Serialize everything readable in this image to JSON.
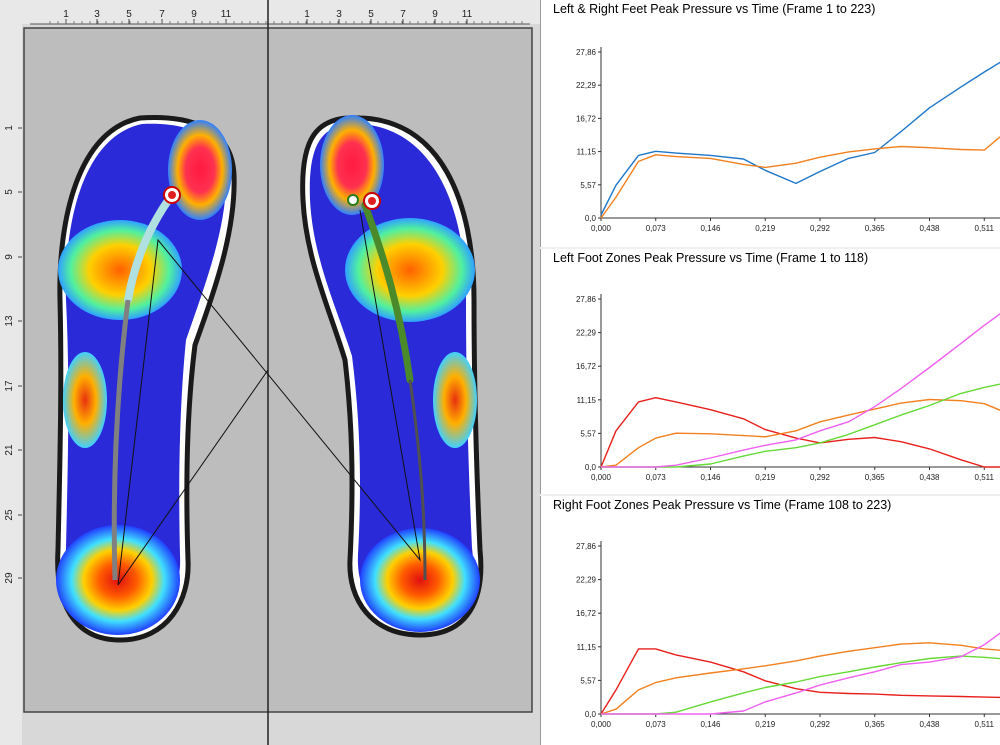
{
  "colors": {
    "series_blue": "#1f77c9",
    "series_orange": "#f28020",
    "series_red": "#e8201c",
    "series_green": "#66d936",
    "series_magenta": "#f060f0",
    "panel_grey": "#bdbdbd"
  },
  "ruler": {
    "top_labels": [
      "1",
      "3",
      "5",
      "7",
      "9",
      "11",
      "1",
      "3",
      "5",
      "7",
      "9",
      "11"
    ],
    "side_labels": [
      "1",
      "5",
      "9",
      "13",
      "17",
      "21",
      "25",
      "29"
    ]
  },
  "footprint_panel": {
    "left_foot": "left-foot-pressure-map",
    "right_foot": "right-foot-pressure-map",
    "markers": "center-of-pressure-icon"
  },
  "chart_data": [
    {
      "type": "line",
      "title": "Left & Right Feet Peak Pressure vs Time (Frame 1 to 223)",
      "x": [
        0.0,
        0.02,
        0.05,
        0.073,
        0.1,
        0.146,
        0.19,
        0.219,
        0.26,
        0.292,
        0.33,
        0.365,
        0.4,
        0.438,
        0.48,
        0.511,
        0.55
      ],
      "x_ticks": [
        "0,000",
        "0,073",
        "0,146",
        "0,219",
        "0,292",
        "0,365",
        "0,438",
        "0,511"
      ],
      "y_ticks": [
        "0,0",
        "5,57",
        "11,15",
        "16,72",
        "22,29",
        "27,86"
      ],
      "ylim": [
        0,
        27.86
      ],
      "xlim": [
        0,
        0.54
      ],
      "series": [
        {
          "color": "#1f77c9",
          "values": [
            0.5,
            5.5,
            10.5,
            11.2,
            10.9,
            10.5,
            9.9,
            8.0,
            5.8,
            7.8,
            10.0,
            11.0,
            14.5,
            18.5,
            22.0,
            24.5,
            27.5
          ]
        },
        {
          "color": "#f28020",
          "values": [
            0.0,
            3.5,
            9.5,
            10.6,
            10.3,
            10.0,
            9.0,
            8.5,
            9.2,
            10.2,
            11.1,
            11.6,
            12.0,
            11.8,
            11.5,
            11.4,
            15.5
          ]
        }
      ]
    },
    {
      "type": "line",
      "title": "Left Foot Zones Peak Pressure vs Time (Frame 1 to 118)",
      "x": [
        0.0,
        0.02,
        0.05,
        0.073,
        0.1,
        0.146,
        0.19,
        0.219,
        0.26,
        0.292,
        0.33,
        0.365,
        0.4,
        0.438,
        0.48,
        0.511,
        0.55
      ],
      "x_ticks": [
        "0,000",
        "0,073",
        "0,146",
        "0,219",
        "0,292",
        "0,365",
        "0,438",
        "0,511"
      ],
      "y_ticks": [
        "0,0",
        "5,57",
        "11,15",
        "16,72",
        "22,29",
        "27,86"
      ],
      "ylim": [
        0,
        27.86
      ],
      "xlim": [
        0,
        0.54
      ],
      "series": [
        {
          "color": "#e8201c",
          "values": [
            0.0,
            6.0,
            10.8,
            11.5,
            10.8,
            9.5,
            8.0,
            6.2,
            4.8,
            4.0,
            4.6,
            4.9,
            4.2,
            3.0,
            1.2,
            0.0,
            0.0
          ]
        },
        {
          "color": "#f28020",
          "values": [
            0.0,
            0.3,
            3.2,
            4.8,
            5.6,
            5.5,
            5.2,
            5.0,
            6.0,
            7.5,
            8.6,
            9.6,
            10.6,
            11.2,
            11.0,
            10.5,
            8.5
          ]
        },
        {
          "color": "#66d936",
          "values": [
            0.0,
            0.0,
            0.0,
            0.0,
            0.0,
            0.5,
            1.8,
            2.6,
            3.2,
            4.0,
            5.4,
            7.0,
            8.6,
            10.2,
            12.2,
            13.2,
            14.2
          ]
        },
        {
          "color": "#f060f0",
          "values": [
            0.0,
            0.0,
            0.0,
            0.0,
            0.3,
            1.5,
            2.8,
            3.6,
            4.5,
            6.0,
            7.5,
            10.0,
            13.0,
            16.5,
            20.5,
            23.5,
            27.0
          ]
        }
      ]
    },
    {
      "type": "line",
      "title": "Right Foot Zones Peak Pressure vs Time (Frame 108 to 223)",
      "x": [
        0.0,
        0.02,
        0.05,
        0.073,
        0.1,
        0.146,
        0.19,
        0.219,
        0.26,
        0.292,
        0.33,
        0.365,
        0.4,
        0.438,
        0.48,
        0.511,
        0.55
      ],
      "x_ticks": [
        "0,000",
        "0,073",
        "0,146",
        "0,219",
        "0,292",
        "0,365",
        "0,438",
        "0,511"
      ],
      "y_ticks": [
        "0,0",
        "5,57",
        "11,15",
        "16,72",
        "22,29",
        "27,86"
      ],
      "ylim": [
        0,
        27.86
      ],
      "xlim": [
        0,
        0.54
      ],
      "series": [
        {
          "color": "#e8201c",
          "values": [
            0.0,
            4.0,
            10.8,
            10.8,
            9.8,
            8.6,
            7.0,
            5.5,
            4.2,
            3.6,
            3.4,
            3.3,
            3.1,
            3.0,
            2.9,
            2.8,
            2.7
          ]
        },
        {
          "color": "#f28020",
          "values": [
            0.0,
            0.8,
            4.0,
            5.2,
            6.0,
            6.8,
            7.5,
            8.0,
            8.8,
            9.6,
            10.4,
            11.0,
            11.6,
            11.8,
            11.4,
            10.8,
            10.4
          ]
        },
        {
          "color": "#66d936",
          "values": [
            0.0,
            0.0,
            0.0,
            0.0,
            0.3,
            2.0,
            3.5,
            4.4,
            5.3,
            6.2,
            7.0,
            7.8,
            8.5,
            9.2,
            9.6,
            9.4,
            9.0
          ]
        },
        {
          "color": "#f060f0",
          "values": [
            0.0,
            0.0,
            0.0,
            0.0,
            0.0,
            0.0,
            0.5,
            2.0,
            3.5,
            4.8,
            6.0,
            7.0,
            8.2,
            8.6,
            9.5,
            11.5,
            15.0
          ]
        }
      ]
    }
  ]
}
